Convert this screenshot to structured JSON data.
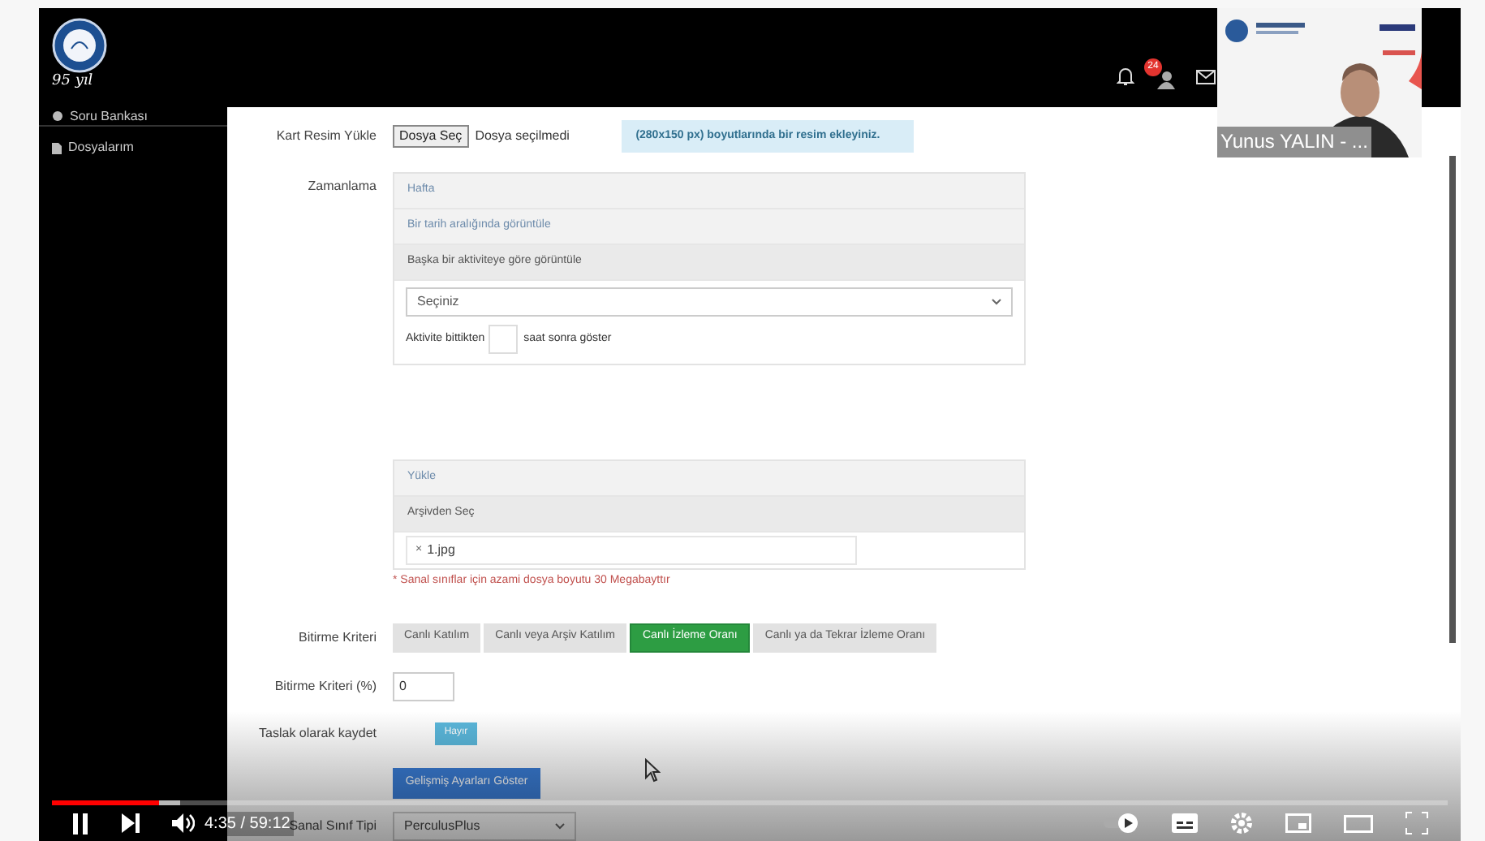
{
  "site": {
    "logo_text": "95 yıl",
    "sidebar": [
      {
        "label": "Soru Bankası"
      },
      {
        "label": "Dosyalarım"
      }
    ],
    "header": {
      "notification_count": "24"
    },
    "form": {
      "card_image": {
        "label": "Kart Resim Yükle",
        "button": "Dosya Seç",
        "status": "Dosya seçilmedi",
        "hint": "(280x150 px) boyutlarında bir resim ekleyiniz."
      },
      "schedule": {
        "label": "Zamanlama",
        "sections": [
          {
            "label": "Hafta",
            "expanded": false
          },
          {
            "label": "Bir tarih aralığında görüntüle",
            "expanded": false
          },
          {
            "label": "Başka bir aktiviteye göre görüntüle",
            "expanded": true
          }
        ],
        "select": "Seçiniz",
        "before_text": "Aktivite bittikten",
        "after_text": "saat sonra göster"
      },
      "attachments": {
        "sections": [
          {
            "label": "Yükle",
            "expanded": false
          },
          {
            "label": "Arşivden Seç",
            "expanded": true
          }
        ],
        "files": [
          {
            "remove": "×",
            "name": "1.jpg"
          }
        ],
        "note": "* Sanal sınıflar için azami dosya boyutu 30 Megabayttır"
      },
      "completion": {
        "label": "Bitirme Kriteri",
        "options": [
          {
            "label": "Canlı Katılım",
            "selected": false
          },
          {
            "label": "Canlı veya Arşiv Katılım",
            "selected": false
          },
          {
            "label": "Canlı İzleme Oranı",
            "selected": true
          },
          {
            "label": "Canlı ya da Tekrar İzleme Oranı",
            "selected": false
          }
        ]
      },
      "completion_percent": {
        "label": "Bitirme Kriteri (%)",
        "value": "0"
      },
      "draft": {
        "label": "Taslak olarak kaydet",
        "on": false,
        "state_text": "Hayır"
      },
      "advanced_button": "Gelişmiş Ayarları Göster",
      "class_type": {
        "label": "Sanal Sınıf Tipi",
        "value": "PerculusPlus"
      }
    }
  },
  "webcam": {
    "name_label": "Yunus YALIN - ..."
  },
  "player": {
    "playing": true,
    "progress": {
      "level": 0.077
    },
    "buffer": {
      "level": 0.092
    },
    "time": "4:35 / 59:12"
  }
}
